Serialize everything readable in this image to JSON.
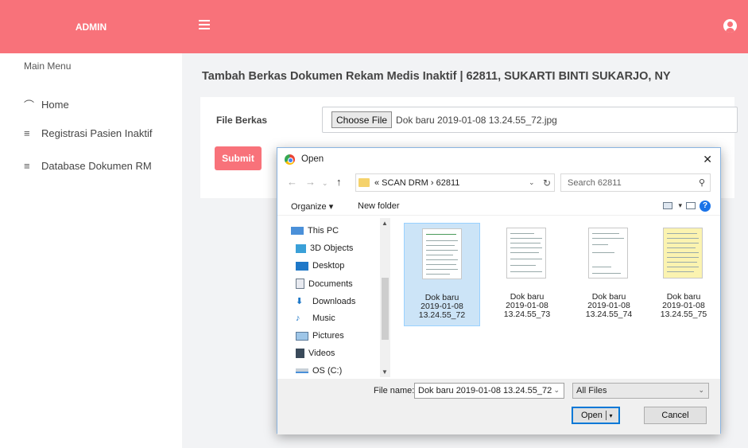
{
  "brand": "ADMIN",
  "sidebar": {
    "menu_title": "Main Menu",
    "items": [
      {
        "icon": "dashboard-icon",
        "label": "Home"
      },
      {
        "icon": "list-icon",
        "label": "Registrasi Pasien Inaktif"
      },
      {
        "icon": "list-icon",
        "label": "Database Dokumen RM"
      }
    ]
  },
  "main": {
    "title": "Tambah Berkas Dokumen Rekam Medis Inaktif | 62811, SUKARTI BINTI SUKARJO, NY",
    "file_label": "File Berkas",
    "choose_label": "Choose File",
    "chosen_file": "Dok baru 2019-01-08 13.24.55_72.jpg",
    "submit_label": "Submit"
  },
  "dialog": {
    "title": "Open",
    "address": "« SCAN DRM › 62811",
    "search_placeholder": "Search 62811",
    "organize": "Organize ▾",
    "new_folder": "New folder",
    "tree": [
      "This PC",
      "3D Objects",
      "Desktop",
      "Documents",
      "Downloads",
      "Music",
      "Pictures",
      "Videos",
      "OS (C:)"
    ],
    "files": [
      {
        "l1": "Dok baru",
        "l2": "2019-01-08",
        "l3": "13.24.55_72"
      },
      {
        "l1": "Dok baru",
        "l2": "2019-01-08",
        "l3": "13.24.55_73"
      },
      {
        "l1": "Dok baru",
        "l2": "2019-01-08",
        "l3": "13.24.55_74"
      },
      {
        "l1": "Dok baru",
        "l2": "2019-01-08",
        "l3": "13.24.55_75"
      }
    ],
    "filename_label": "File name:",
    "filename_value": "Dok baru 2019-01-08 13.24.55_72",
    "filetype": "All Files",
    "open_label": "Open",
    "cancel_label": "Cancel"
  },
  "colors": {
    "accent": "#f8727a",
    "selection": "#cce4f7"
  }
}
